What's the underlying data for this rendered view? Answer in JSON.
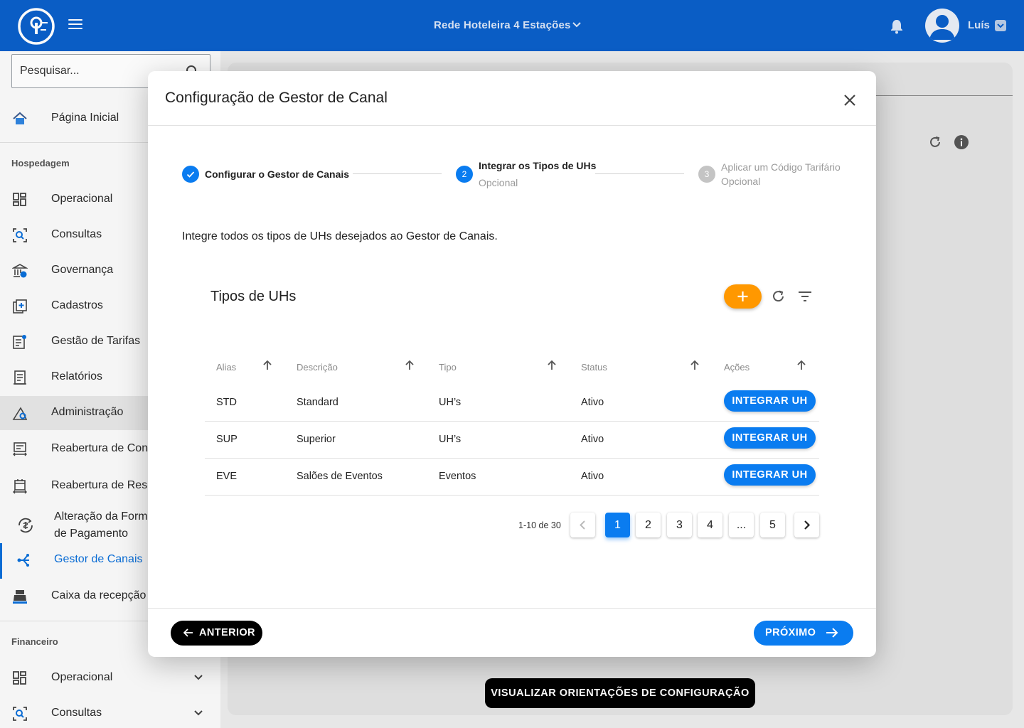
{
  "header": {
    "hotel_name": "Rede Hoteleira 4 Estações",
    "user_name": "Luís"
  },
  "sidebar": {
    "search_placeholder": "Pesquisar...",
    "home": "Página Inicial",
    "section_hospedagem": "Hospedagem",
    "items_hospedagem": [
      {
        "label": "Operacional"
      },
      {
        "label": "Consultas"
      },
      {
        "label": "Governança"
      },
      {
        "label": "Cadastros"
      },
      {
        "label": "Gestão de Tarifas"
      },
      {
        "label": "Relatórios"
      },
      {
        "label": "Administração"
      },
      {
        "label": "Reabertura de Conta"
      },
      {
        "label": "Reabertura de Reserva"
      },
      {
        "label": "Alteração da Forma de Pagamento"
      },
      {
        "label": "Gestor de Canais"
      },
      {
        "label": "Caixa da recepção"
      }
    ],
    "section_financeiro": "Financeiro",
    "items_financeiro": [
      {
        "label": "Operacional"
      },
      {
        "label": "Consultas"
      }
    ]
  },
  "background": {
    "guide_button": "VISUALIZAR ORIENTAÇÕES DE CONFIGURAÇÃO"
  },
  "modal": {
    "title": "Configuração de Gestor de Canal",
    "steps": [
      {
        "number": "1",
        "label": "Configurar o Gestor de Canais",
        "sublabel": "",
        "state": "done"
      },
      {
        "number": "2",
        "label": "Integrar os Tipos de UHs",
        "sublabel": "Opcional",
        "state": "active"
      },
      {
        "number": "3",
        "label": "Aplicar um Código Tarifário",
        "sublabel": "Opcional",
        "state": "pending"
      }
    ],
    "intro": "Integre todos os tipos de UHs desejados ao  Gestor de Canais.",
    "table": {
      "title": "Tipos de UHs",
      "columns": [
        "Alias",
        "Descrição",
        "Tipo",
        "Status",
        "Ações"
      ],
      "rows": [
        {
          "alias": "STD",
          "descricao": "Standard",
          "tipo": "UH’s",
          "status": "Ativo",
          "action": "INTEGRAR UH"
        },
        {
          "alias": "SUP",
          "descricao": "Superior",
          "tipo": "UH’s",
          "status": "Ativo",
          "action": "INTEGRAR UH"
        },
        {
          "alias": "EVE",
          "descricao": "Salões de Eventos",
          "tipo": "Eventos",
          "status": "Ativo",
          "action": "INTEGRAR UH"
        }
      ]
    },
    "pagination": {
      "info": "1-10 de 30",
      "pages": [
        "1",
        "2",
        "3",
        "4",
        "...",
        "5"
      ],
      "current": "1"
    },
    "footer": {
      "prev_label": "ANTERIOR",
      "next_label": "PRÓXIMO"
    }
  },
  "colors": {
    "brand_blue": "#0b5fc9",
    "accent_blue": "#0a7cf0",
    "orange": "#ff9800"
  }
}
